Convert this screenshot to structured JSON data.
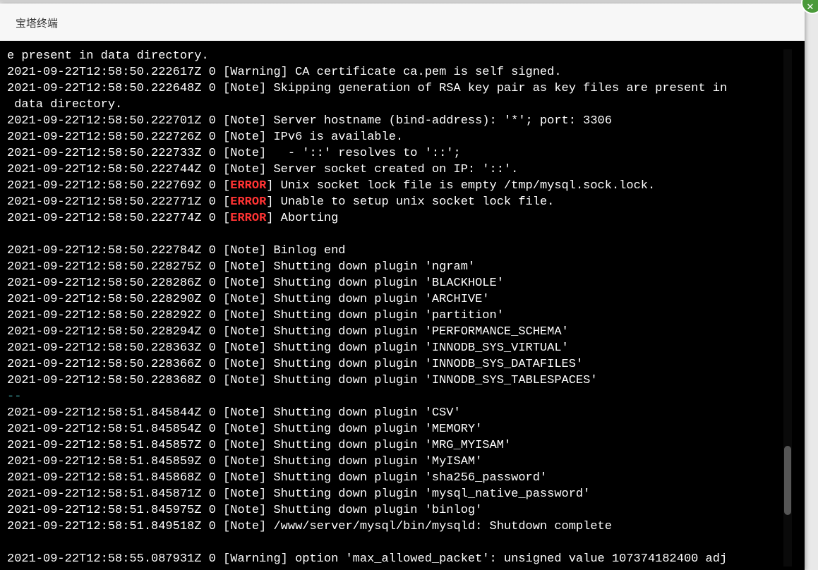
{
  "window": {
    "title": "宝塔终端"
  },
  "terminal": {
    "lines": [
      [
        {
          "t": "e present in data directory."
        }
      ],
      [
        {
          "t": "2021-09-22T12:58:50.222617Z 0 [Warning] CA certificate ca.pem is self signed."
        }
      ],
      [
        {
          "t": "2021-09-22T12:58:50.222648Z 0 [Note] Skipping generation of RSA key pair as key files are present in"
        }
      ],
      [
        {
          "t": " data directory."
        }
      ],
      [
        {
          "t": "2021-09-22T12:58:50.222701Z 0 [Note] Server hostname (bind-address): '*'; port: 3306"
        }
      ],
      [
        {
          "t": "2021-09-22T12:58:50.222726Z 0 [Note] IPv6 is available."
        }
      ],
      [
        {
          "t": "2021-09-22T12:58:50.222733Z 0 [Note]   - '::' resolves to '::';"
        }
      ],
      [
        {
          "t": "2021-09-22T12:58:50.222744Z 0 [Note] Server socket created on IP: '::'."
        }
      ],
      [
        {
          "t": "2021-09-22T12:58:50.222769Z 0 ["
        },
        {
          "t": "ERROR",
          "err": true
        },
        {
          "t": "] Unix socket lock file is empty /tmp/mysql.sock.lock."
        }
      ],
      [
        {
          "t": "2021-09-22T12:58:50.222771Z 0 ["
        },
        {
          "t": "ERROR",
          "err": true
        },
        {
          "t": "] Unable to setup unix socket lock file."
        }
      ],
      [
        {
          "t": "2021-09-22T12:58:50.222774Z 0 ["
        },
        {
          "t": "ERROR",
          "err": true
        },
        {
          "t": "] Aborting"
        }
      ],
      [
        {
          "t": ""
        }
      ],
      [
        {
          "t": "2021-09-22T12:58:50.222784Z 0 [Note] Binlog end"
        }
      ],
      [
        {
          "t": "2021-09-22T12:58:50.228275Z 0 [Note] Shutting down plugin 'ngram'"
        }
      ],
      [
        {
          "t": "2021-09-22T12:58:50.228286Z 0 [Note] Shutting down plugin 'BLACKHOLE'"
        }
      ],
      [
        {
          "t": "2021-09-22T12:58:50.228290Z 0 [Note] Shutting down plugin 'ARCHIVE'"
        }
      ],
      [
        {
          "t": "2021-09-22T12:58:50.228292Z 0 [Note] Shutting down plugin 'partition'"
        }
      ],
      [
        {
          "t": "2021-09-22T12:58:50.228294Z 0 [Note] Shutting down plugin 'PERFORMANCE_SCHEMA'"
        }
      ],
      [
        {
          "t": "2021-09-22T12:58:50.228363Z 0 [Note] Shutting down plugin 'INNODB_SYS_VIRTUAL'"
        }
      ],
      [
        {
          "t": "2021-09-22T12:58:50.228366Z 0 [Note] Shutting down plugin 'INNODB_SYS_DATAFILES'"
        }
      ],
      [
        {
          "t": "2021-09-22T12:58:50.228368Z 0 [Note] Shutting down plugin 'INNODB_SYS_TABLESPACES'"
        }
      ],
      [
        {
          "t": "--",
          "sep": true
        }
      ],
      [
        {
          "t": "2021-09-22T12:58:51.845844Z 0 [Note] Shutting down plugin 'CSV'"
        }
      ],
      [
        {
          "t": "2021-09-22T12:58:51.845854Z 0 [Note] Shutting down plugin 'MEMORY'"
        }
      ],
      [
        {
          "t": "2021-09-22T12:58:51.845857Z 0 [Note] Shutting down plugin 'MRG_MYISAM'"
        }
      ],
      [
        {
          "t": "2021-09-22T12:58:51.845859Z 0 [Note] Shutting down plugin 'MyISAM'"
        }
      ],
      [
        {
          "t": "2021-09-22T12:58:51.845868Z 0 [Note] Shutting down plugin 'sha256_password'"
        }
      ],
      [
        {
          "t": "2021-09-22T12:58:51.845871Z 0 [Note] Shutting down plugin 'mysql_native_password'"
        }
      ],
      [
        {
          "t": "2021-09-22T12:58:51.845975Z 0 [Note] Shutting down plugin 'binlog'"
        }
      ],
      [
        {
          "t": "2021-09-22T12:58:51.849518Z 0 [Note] /www/server/mysql/bin/mysqld: Shutdown complete"
        }
      ],
      [
        {
          "t": ""
        }
      ],
      [
        {
          "t": "2021-09-22T12:58:55.087931Z 0 [Warning] option 'max_allowed_packet': unsigned value 107374182400 adj"
        }
      ]
    ]
  },
  "colors": {
    "terminal_bg": "#000000",
    "terminal_text": "#ffffff",
    "error": "#ff3333",
    "separator": "#3a9a9a"
  },
  "icons": {
    "corner_badge": "close-icon"
  }
}
